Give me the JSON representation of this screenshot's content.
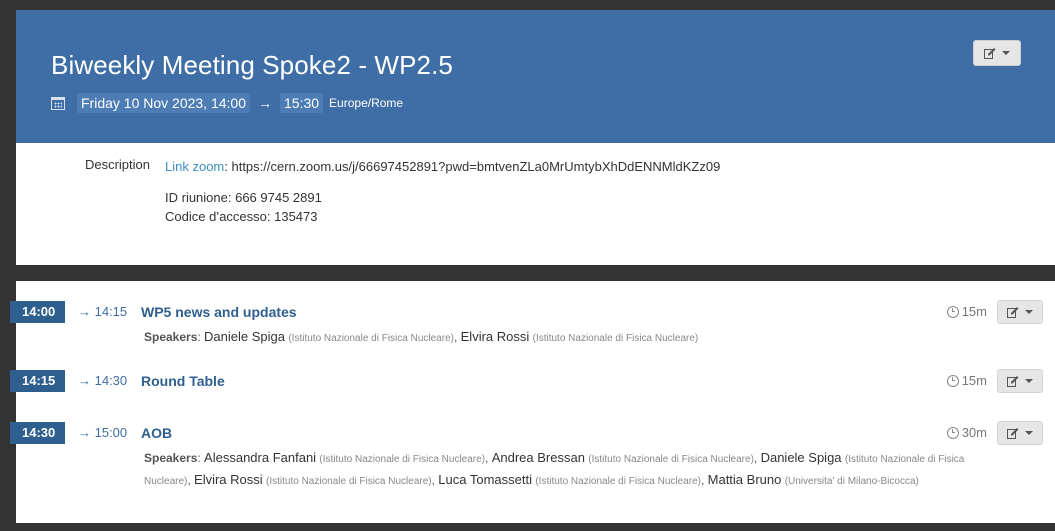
{
  "event": {
    "title": "Biweekly Meeting Spoke2 - WP2.5",
    "date": "Friday 10 Nov 2023, 14:00",
    "arrow": "→",
    "end_time": "15:30",
    "timezone": "Europe/Rome",
    "header_color": "#3e6ea5"
  },
  "description": {
    "label": "Description",
    "link_text": "Link zoom",
    "link_rest": ": https://cern.zoom.us/j/66697452891?pwd=bmtvenZLa0MrUmtybXhDdENNMldKZz09",
    "meeting_id": "ID riunione: 666 9745 2891",
    "access_code": "Codice d’accesso: 135473"
  },
  "timetable": {
    "items": [
      {
        "start": "14:00",
        "end": "→ 14:15",
        "title": "WP5 news and updates",
        "duration": "15m",
        "speakers_label": "Speakers",
        "speakers": [
          {
            "name": "Daniele Spiga",
            "aff": "(Istituto Nazionale di Fisica Nucleare)"
          },
          {
            "name": "Elvira Rossi",
            "aff": "(Istituto Nazionale di Fisica Nucleare)"
          }
        ]
      },
      {
        "start": "14:15",
        "end": "→ 14:30",
        "title": "Round Table",
        "duration": "15m",
        "speakers_label": "",
        "speakers": []
      },
      {
        "start": "14:30",
        "end": "→ 15:00",
        "title": "AOB",
        "duration": "30m",
        "speakers_label": "Speakers",
        "speakers": [
          {
            "name": "Alessandra Fanfani",
            "aff": "(Istituto Nazionale di Fisica Nucleare)"
          },
          {
            "name": "Andrea Bressan",
            "aff": "(Istituto Nazionale di Fisica Nucleare)"
          },
          {
            "name": "Daniele Spiga",
            "aff": "(Istituto Nazionale di Fisica Nucleare)"
          },
          {
            "name": "Elvira Rossi",
            "aff": "(Istituto Nazionale di Fisica Nucleare)"
          },
          {
            "name": "Luca Tomassetti",
            "aff": "(Istituto Nazionale di Fisica Nucleare)"
          },
          {
            "name": "Mattia Bruno",
            "aff": "(Universita' di Milano-Bicocca)"
          }
        ]
      }
    ]
  },
  "icons": {
    "calendar": "calendar-icon",
    "edit": "edit-icon",
    "clock": "clock-icon",
    "caret": "chevron-down-icon"
  }
}
